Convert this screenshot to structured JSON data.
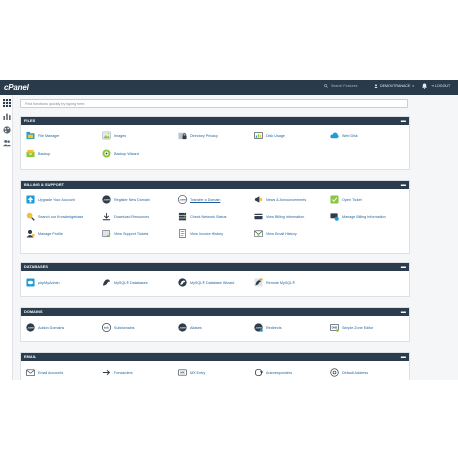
{
  "app": {
    "logo": "cPanel"
  },
  "topbar": {
    "search_placeholder": "Search Features",
    "user": "DEMOXTRANACE",
    "logout": "LOGOUT"
  },
  "find": {
    "placeholder": "Find functions quickly by typing here."
  },
  "colors": {
    "topbar": "#293a4a",
    "section_header": "#2b3c4d",
    "link": "#1f5f99",
    "green": "#8cc63e",
    "blue": "#1f9cd8",
    "yellow": "#f2c230",
    "dark": "#2f3d4a"
  },
  "sections": {
    "files": {
      "title": "FILES",
      "items": [
        {
          "label": "File Manager",
          "icon": "file-manager-icon"
        },
        {
          "label": "Images",
          "icon": "images-icon"
        },
        {
          "label": "Directory Privacy",
          "icon": "directory-privacy-icon"
        },
        {
          "label": "Disk Usage",
          "icon": "disk-usage-icon"
        },
        {
          "label": "Web Disk",
          "icon": "web-disk-icon"
        },
        {
          "label": "Backup",
          "icon": "backup-icon"
        },
        {
          "label": "Backup Wizard",
          "icon": "backup-wizard-icon"
        }
      ]
    },
    "billing": {
      "title": "BILLING & SUPPORT",
      "items": [
        {
          "label": "Upgrade Your Account",
          "icon": "upgrade-icon"
        },
        {
          "label": "Register New Domain",
          "icon": "register-domain-icon"
        },
        {
          "label": "Transfer a Domain",
          "icon": "transfer-domain-icon"
        },
        {
          "label": "News & Announcements",
          "icon": "news-icon"
        },
        {
          "label": "Open Ticket",
          "icon": "open-ticket-icon"
        },
        {
          "label": "Search our Knowledgebase",
          "icon": "knowledgebase-icon"
        },
        {
          "label": "Download Resources",
          "icon": "download-icon"
        },
        {
          "label": "Check Network Status",
          "icon": "network-status-icon"
        },
        {
          "label": "View Billing Information",
          "icon": "billing-info-icon"
        },
        {
          "label": "Manage Billing Information",
          "icon": "manage-billing-icon"
        },
        {
          "label": "Manage Profile",
          "icon": "profile-icon"
        },
        {
          "label": "View Support Tickets",
          "icon": "support-tickets-icon"
        },
        {
          "label": "View Invoice History",
          "icon": "invoice-icon"
        },
        {
          "label": "View Email History",
          "icon": "email-history-icon"
        }
      ]
    },
    "databases": {
      "title": "DATABASES",
      "items": [
        {
          "label": "phpMyAdmin",
          "icon": "phpmyadmin-icon"
        },
        {
          "label": "MySQL® Databases",
          "icon": "mysql-icon"
        },
        {
          "label": "MySQL® Database Wizard",
          "icon": "mysql-wizard-icon"
        },
        {
          "label": "Remote MySQL®",
          "icon": "remote-mysql-icon"
        }
      ]
    },
    "domains": {
      "title": "DOMAINS",
      "items": [
        {
          "label": "Addon Domains",
          "icon": "addon-domains-icon"
        },
        {
          "label": "Subdomains",
          "icon": "subdomains-icon"
        },
        {
          "label": "Aliases",
          "icon": "aliases-icon"
        },
        {
          "label": "Redirects",
          "icon": "redirects-icon"
        },
        {
          "label": "Simple Zone Editor",
          "icon": "zone-editor-icon"
        }
      ]
    },
    "email": {
      "title": "EMAIL",
      "items": [
        {
          "label": "Email Accounts",
          "icon": "email-accounts-icon"
        },
        {
          "label": "Forwarders",
          "icon": "forwarders-icon"
        },
        {
          "label": "MX Entry",
          "icon": "mx-entry-icon"
        },
        {
          "label": "Autoresponders",
          "icon": "autoresponders-icon"
        },
        {
          "label": "Default Address",
          "icon": "default-address-icon"
        }
      ]
    }
  },
  "icon_text": {
    "com": ".com",
    "sub": "sub.",
    "dns": "DNS",
    "mx": "MX"
  }
}
